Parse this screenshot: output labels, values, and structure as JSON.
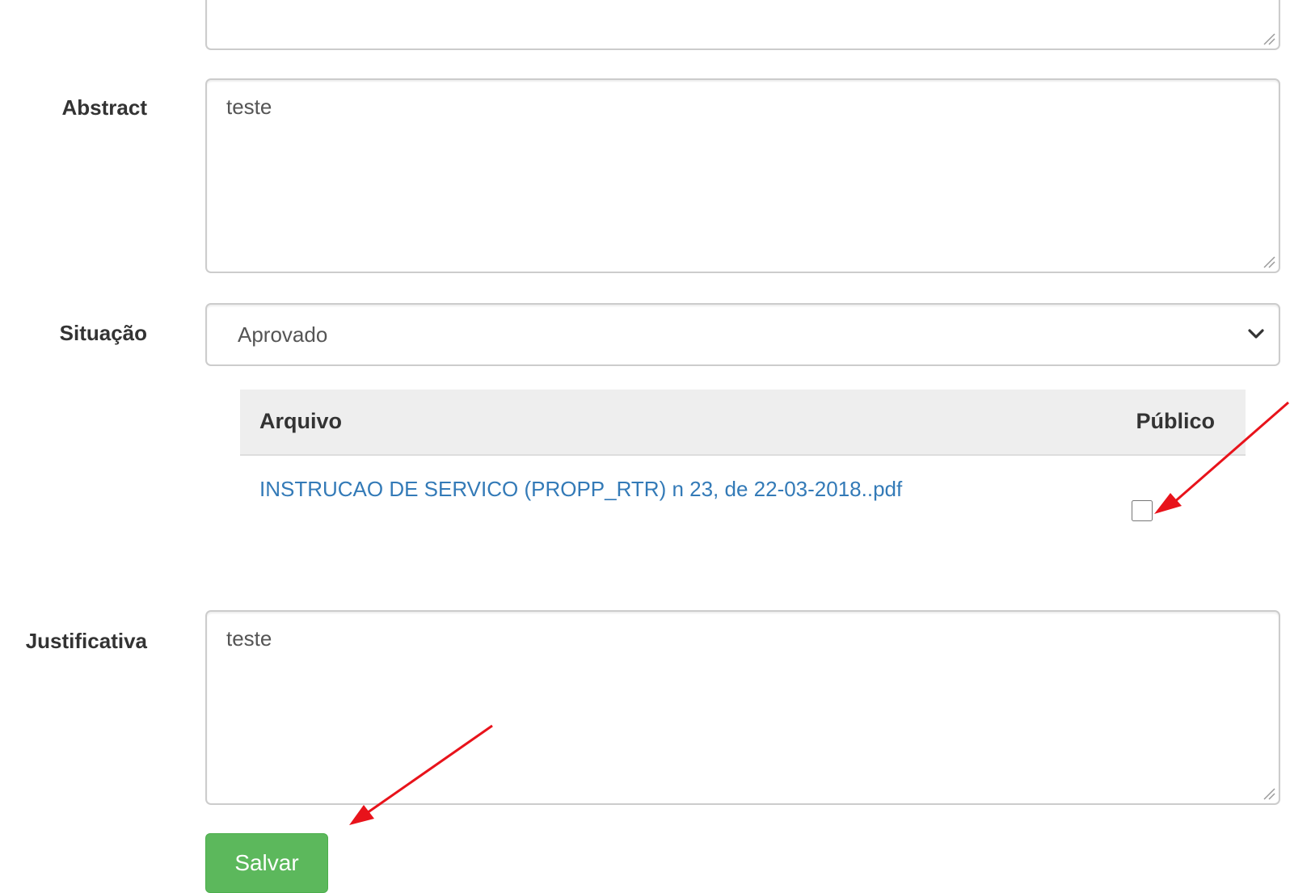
{
  "form": {
    "top_textarea": {
      "value": ""
    },
    "abstract": {
      "label": "Abstract",
      "value": "teste"
    },
    "situacao": {
      "label": "Situação",
      "selected": "Aprovado"
    },
    "files_table": {
      "headers": {
        "file": "Arquivo",
        "public": "Público"
      },
      "rows": [
        {
          "file_name": "INSTRUCAO DE SERVICO (PROPP_RTR) n 23, de 22-03-2018..pdf",
          "public": false
        }
      ]
    },
    "justificativa": {
      "label": "Justificativa",
      "value": "teste"
    },
    "save_button": {
      "label": "Salvar"
    }
  },
  "colors": {
    "link": "#337ab7",
    "success_button": "#5cb85c",
    "annotation_arrow": "#e8131b",
    "table_header_bg": "#eeeeee"
  },
  "icons": {
    "select_caret": "chevron-down-icon",
    "textarea_resize": "resize-grip-icon"
  }
}
